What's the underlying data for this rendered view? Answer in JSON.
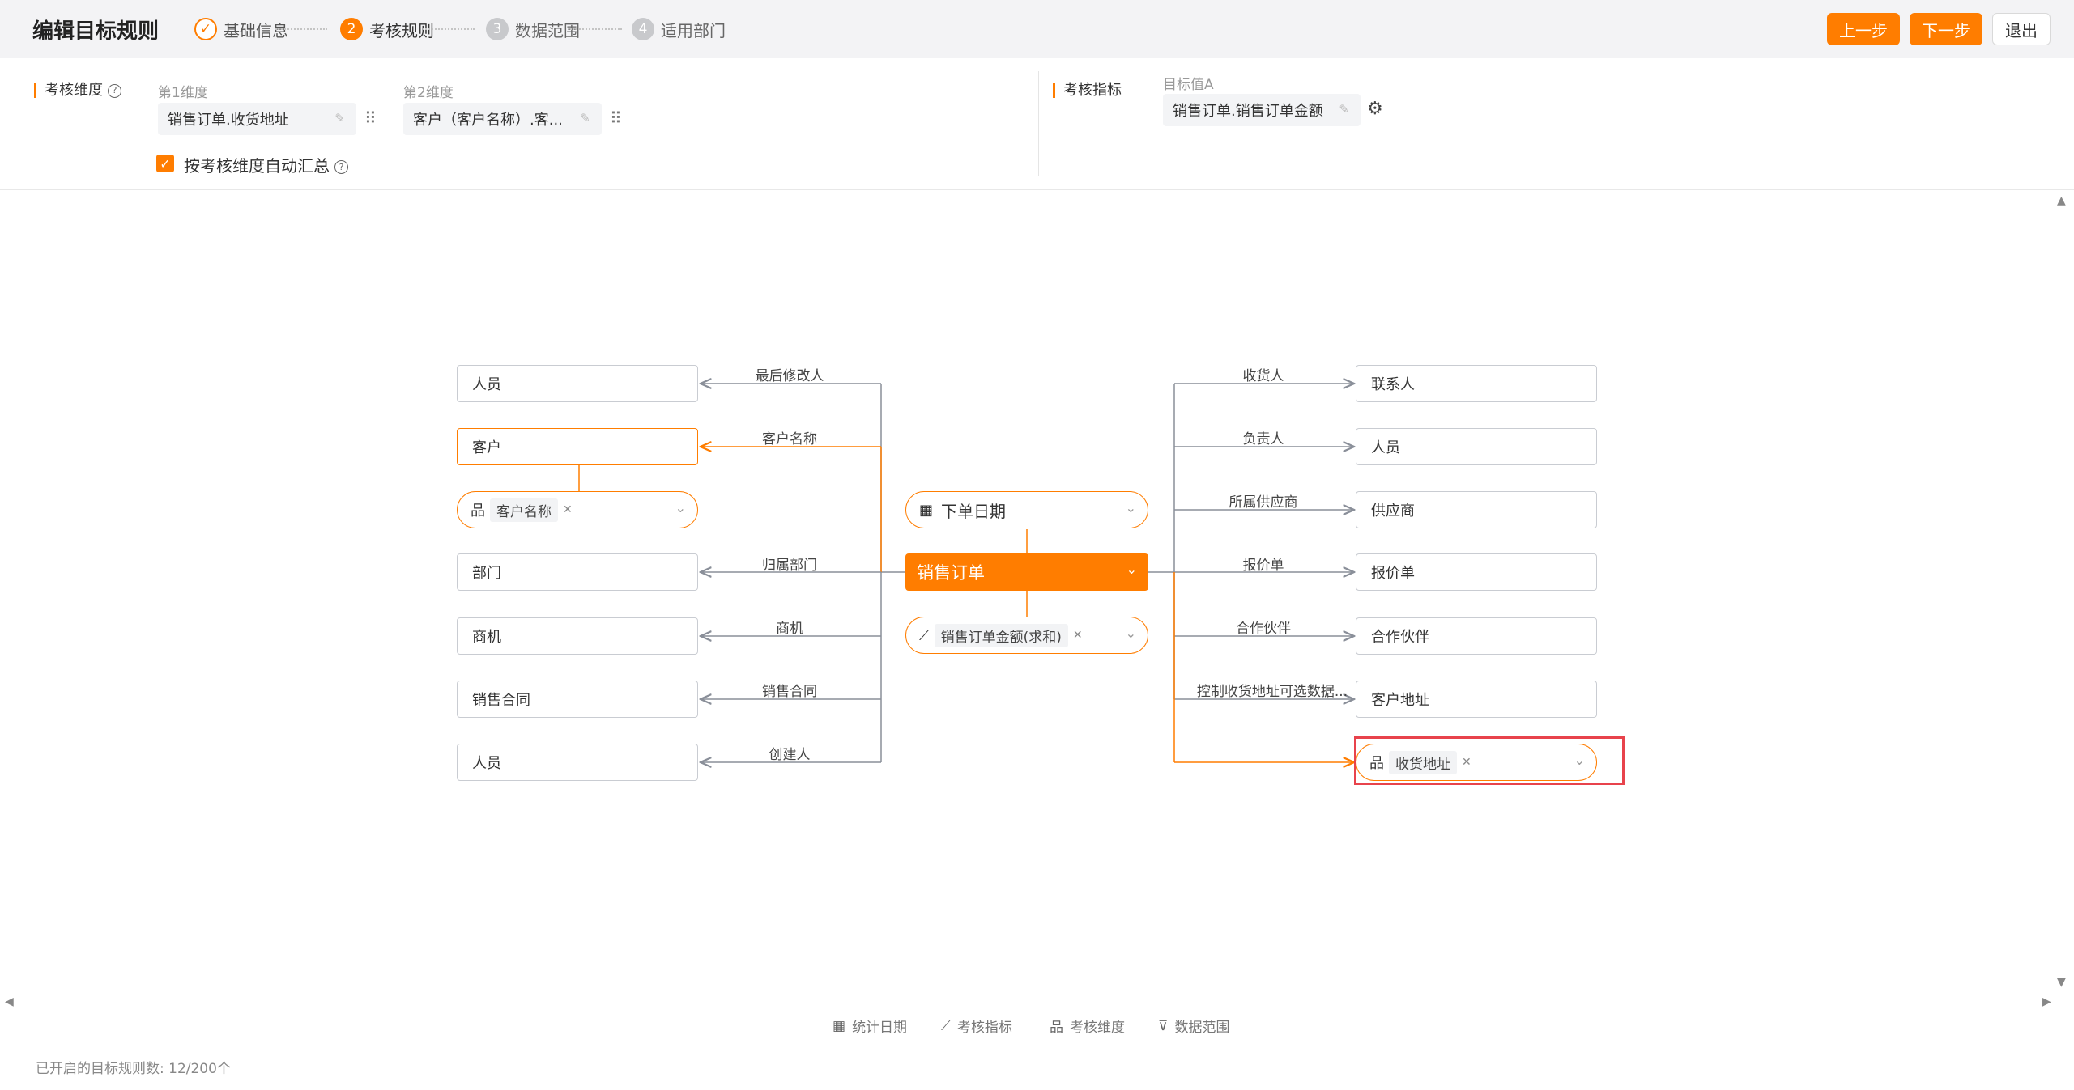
{
  "header": {
    "title": "编辑目标规则",
    "steps": [
      {
        "num": "✓",
        "label": "基础信息"
      },
      {
        "num": "2",
        "label": "考核规则"
      },
      {
        "num": "3",
        "label": "数据范围"
      },
      {
        "num": "4",
        "label": "适用部门"
      }
    ],
    "prev_label": "上一步",
    "next_label": "下一步",
    "exit_label": "退出"
  },
  "config": {
    "dimension_label": "考核维度",
    "dim1_label": "第1维度",
    "dim1_value": "销售订单.收货地址",
    "dim2_label": "第2维度",
    "dim2_value": "客户（客户名称）.客...",
    "auto_summary_label": "按考核维度自动汇总",
    "indicator_label": "考核指标",
    "target_label": "目标值A",
    "target_value": "销售订单.销售订单金额"
  },
  "canvas": {
    "center": "销售订单",
    "date_pill": "下单日期",
    "metric_pill": "销售订单金额(求和)",
    "left_nodes": [
      {
        "edge": "最后修改人",
        "node": "人员"
      },
      {
        "edge": "客户名称",
        "node": "客户"
      },
      {
        "edge": "归属部门",
        "node": "部门"
      },
      {
        "edge": "商机",
        "node": "商机"
      },
      {
        "edge": "销售合同",
        "node": "销售合同"
      },
      {
        "edge": "创建人",
        "node": "人员"
      }
    ],
    "left_dim_pill": "客户名称",
    "right_nodes": [
      {
        "edge": "收货人",
        "node": "联系人"
      },
      {
        "edge": "负责人",
        "node": "人员"
      },
      {
        "edge": "所属供应商",
        "node": "供应商"
      },
      {
        "edge": "报价单",
        "node": "报价单"
      },
      {
        "edge": "合作伙伴",
        "node": "合作伙伴"
      },
      {
        "edge": "控制收货地址可选数据...",
        "node": "客户地址"
      }
    ],
    "right_dim_pill": "收货地址"
  },
  "toolbar": {
    "items": [
      {
        "icon": "calendar-icon",
        "label": "统计日期"
      },
      {
        "icon": "chart-line-icon",
        "label": "考核指标"
      },
      {
        "icon": "hierarchy-icon",
        "label": "考核维度"
      },
      {
        "icon": "filter-icon",
        "label": "数据范围"
      }
    ]
  },
  "footer": {
    "status": "已开启的目标规则数: 12/200个"
  },
  "colors": {
    "accent": "#ff7d00",
    "highlight": "#e8434c",
    "node_border": "#c9ccd2"
  }
}
